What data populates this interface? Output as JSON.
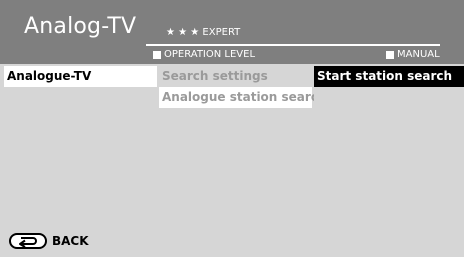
{
  "header": {
    "title": "Analog-TV",
    "level_stars": "★ ★ ★ EXPERT",
    "operation_level_label": "OPERATION LEVEL",
    "manual_label": "MANUAL"
  },
  "columns": {
    "left": {
      "items": [
        {
          "label": "Analogue-TV"
        }
      ]
    },
    "middle": {
      "items": [
        {
          "label": "Search settings"
        },
        {
          "label": "Analogue station search"
        }
      ]
    },
    "right": {
      "items": [
        {
          "label": "Start station search"
        }
      ]
    }
  },
  "footer": {
    "back_label": "BACK",
    "back_icon": "return-arrow-icon"
  }
}
